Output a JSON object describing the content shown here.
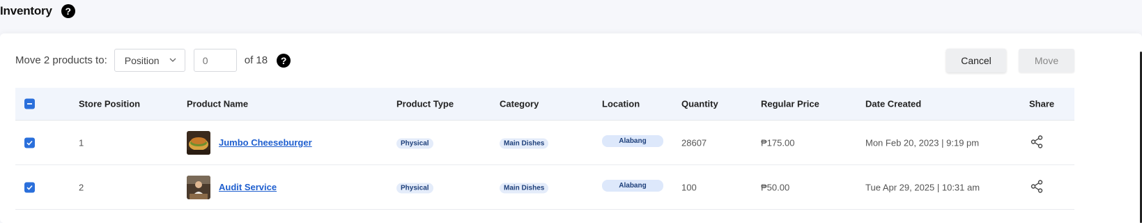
{
  "page": {
    "title": "Inventory"
  },
  "toolbar": {
    "move_label": "Move 2 products to:",
    "position_select": "Position",
    "position_input_placeholder": "0",
    "of_label": "of 18",
    "cancel_label": "Cancel",
    "move_label_btn": "Move"
  },
  "table": {
    "headers": {
      "store_position": "Store Position",
      "product_name": "Product Name",
      "product_type": "Product Type",
      "category": "Category",
      "location": "Location",
      "quantity": "Quantity",
      "regular_price": "Regular Price",
      "date_created": "Date Created",
      "share": "Share"
    },
    "rows": [
      {
        "store_position": "1",
        "product_name": "Jumbo Cheeseburger",
        "product_type": "Physical",
        "category": "Main Dishes",
        "location": "Alabang",
        "quantity": "28607",
        "regular_price": "₱175.00",
        "date_created": "Mon Feb 20, 2023 | 9:19 pm"
      },
      {
        "store_position": "2",
        "product_name": "Audit Service",
        "product_type": "Physical",
        "category": "Main Dishes",
        "location": "Alabang",
        "quantity": "100",
        "regular_price": "₱50.00",
        "date_created": "Tue Apr 29, 2025 | 10:31 am"
      }
    ]
  },
  "colors": {
    "accent": "#2a6fdb",
    "link": "#1f5fcf",
    "header_bg": "#f1f5fc",
    "pill_bg": "#e4ecfa"
  }
}
